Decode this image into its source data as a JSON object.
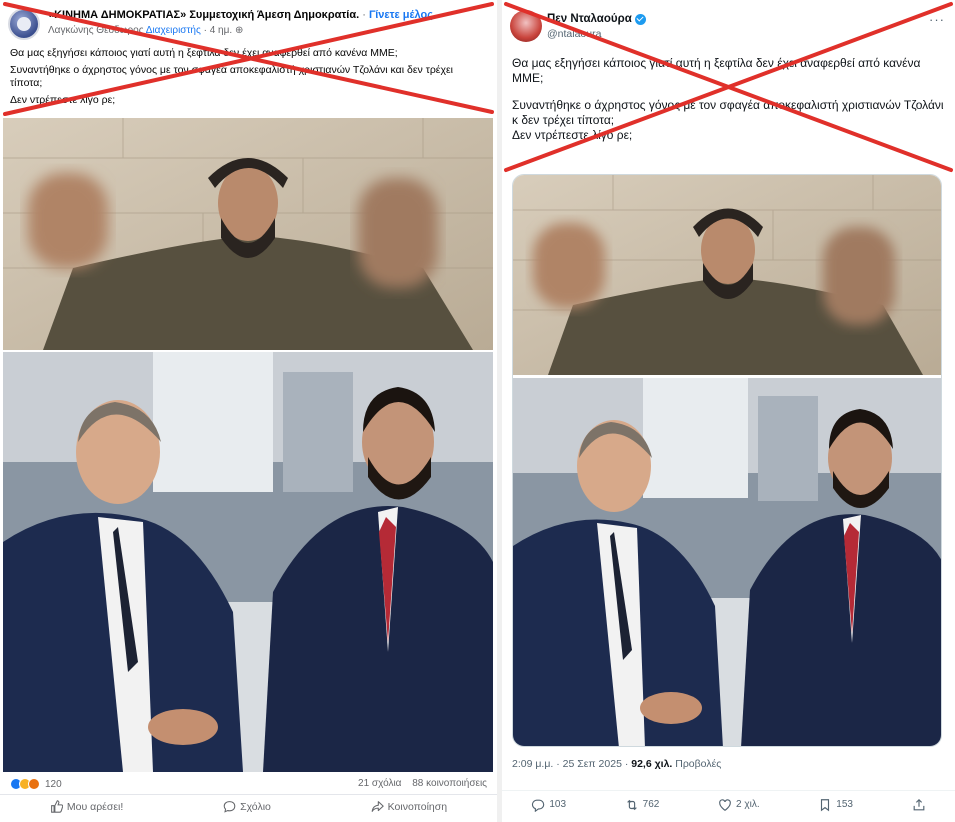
{
  "facebook": {
    "group_name": "«ΚΙΝΗΜΑ ΔΗΜΟΚΡΑΤΙΑΣ» Συμμετοχική Άμεση Δημοκρατία.",
    "join_label": "Γίνετε μέλος",
    "author": "Λαγκώνης Θεοδωρος",
    "author_role": "Διαχειριστής",
    "time": "4 ημ.",
    "text": {
      "line1": "Θα μας εξηγήσει κάποιος γιατί αυτή η ξεφτίλα δεν έχει αναφερθεί από κανένα ΜΜΕ;",
      "line2": "Συναντήθηκε ο άχρηστος γόνος με τον σφαγέα αποκεφαλιστή χριστιανών Τζολάνι και δεν τρέχει τίποτα;",
      "line3": "Δεν ντρέπεστε λίγο ρε;"
    },
    "reaction_count": "120",
    "comments": "21 σχόλια",
    "shares": "88 κοινοποιήσεις",
    "actions": {
      "like": "Μου αρέσει!",
      "comment": "Σχόλιο",
      "share": "Κοινοποίηση"
    }
  },
  "twitter": {
    "name": "Πεν Νταλαούρα",
    "handle": "@ntalaoura",
    "text": {
      "p1": "Θα μας εξηγήσει κάποιος γιατί αυτή η ξεφτίλα δεν έχει αναφερθεί από κανένα ΜΜΕ;",
      "p2": "Συναντήθηκε ο άχρηστος γόνος με τον σφαγέα αποκεφαλιστή χριστιανών Τζολάνι κ δεν τρέχει τίποτα;",
      "p3": "Δεν ντρέπεστε λίγο ρε;"
    },
    "timestamp": "2:09 μ.μ. · 25 Σεπ 2025 ·",
    "views_count": "92,6 χιλ.",
    "views_label": "Προβολές",
    "replies": "103",
    "reposts": "762",
    "likes": "2 χιλ.",
    "bookmarks": "153"
  },
  "colors": {
    "cross": "#e0302a",
    "fb_blue": "#1877f2",
    "x_blue": "#1d9bf0"
  },
  "icons": [
    "like-icon",
    "comment-icon",
    "share-icon",
    "reply-icon",
    "repost-icon",
    "heart-icon",
    "bookmark-icon",
    "upload-icon",
    "verified-icon"
  ]
}
